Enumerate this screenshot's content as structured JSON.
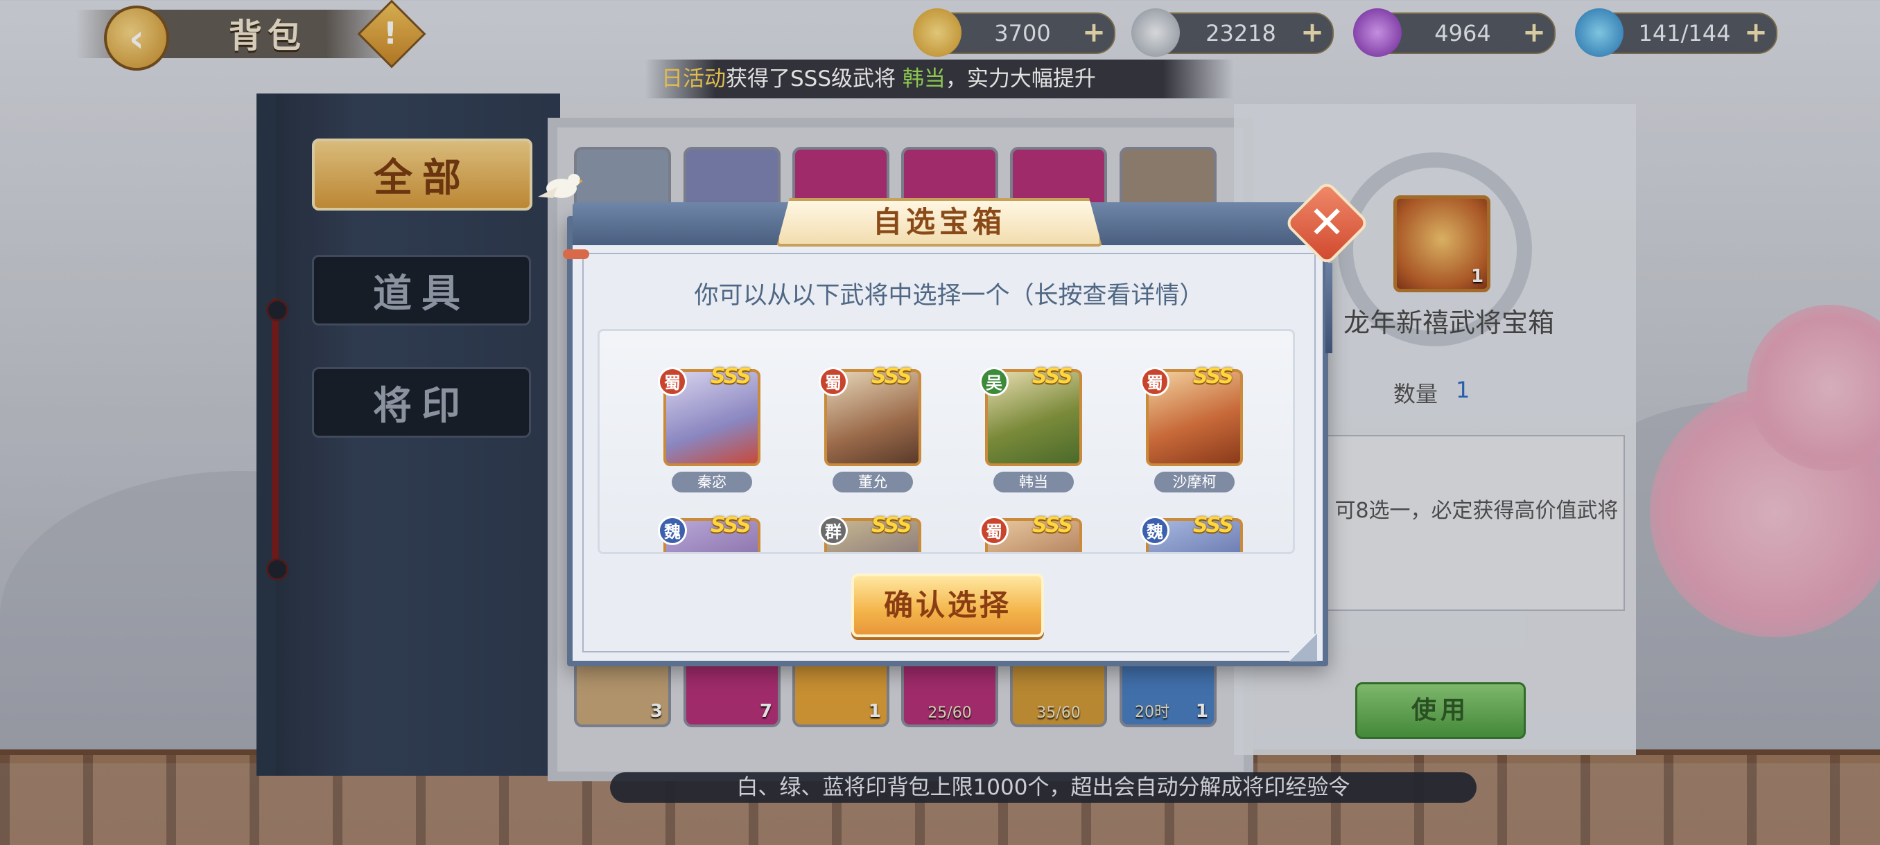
{
  "top_bar": {
    "title": "背包",
    "resources": [
      {
        "name": "gold-ingot",
        "value": "3700",
        "color": "#e8b53a"
      },
      {
        "name": "silver-ingot",
        "value": "23218",
        "color": "#c7ccd6"
      },
      {
        "name": "purple-orb",
        "value": "4964",
        "color": "#a34ad6"
      },
      {
        "name": "stamina",
        "value": "141/144",
        "color": "#3aa6e6"
      }
    ]
  },
  "marquee": {
    "part1": "日活动",
    "part2": "获得了SSS级武将 ",
    "part3": "韩当",
    "part4": "，实力大幅提升"
  },
  "side_tabs": {
    "all": "全部",
    "items": "道具",
    "seals": "将印"
  },
  "grid_items": {
    "counts": [
      "3",
      "7",
      "1",
      "1"
    ],
    "fractions": [
      "25/60",
      "35/60"
    ],
    "last_count": "1",
    "timer": "20时"
  },
  "detail": {
    "icon_count": "1",
    "name": "龙年新禧武将宝箱",
    "qty_label": "数量",
    "qty_value": "1",
    "desc": "可8选一，必定获得高价值武将",
    "use_button": "使用"
  },
  "notice": "白、绿、蓝将印背包上限1000个，超出会自动分解成将印经验令",
  "modal": {
    "title": "自选宝箱",
    "subtitle": "你可以从以下武将中选择一个（长按查看详情）",
    "confirm_button": "确认选择",
    "heroes": [
      {
        "name": "秦宓",
        "faction": "蜀",
        "grade": "SSS"
      },
      {
        "name": "董允",
        "faction": "蜀",
        "grade": "SSS"
      },
      {
        "name": "韩当",
        "faction": "吴",
        "grade": "SSS"
      },
      {
        "name": "沙摩柯",
        "faction": "蜀",
        "grade": "SSS"
      },
      {
        "name": "",
        "faction": "魏",
        "grade": "SSS"
      },
      {
        "name": "",
        "faction": "群",
        "grade": "SSS"
      },
      {
        "name": "",
        "faction": "蜀",
        "grade": "SSS"
      },
      {
        "name": "",
        "faction": "魏",
        "grade": "SSS"
      }
    ]
  }
}
